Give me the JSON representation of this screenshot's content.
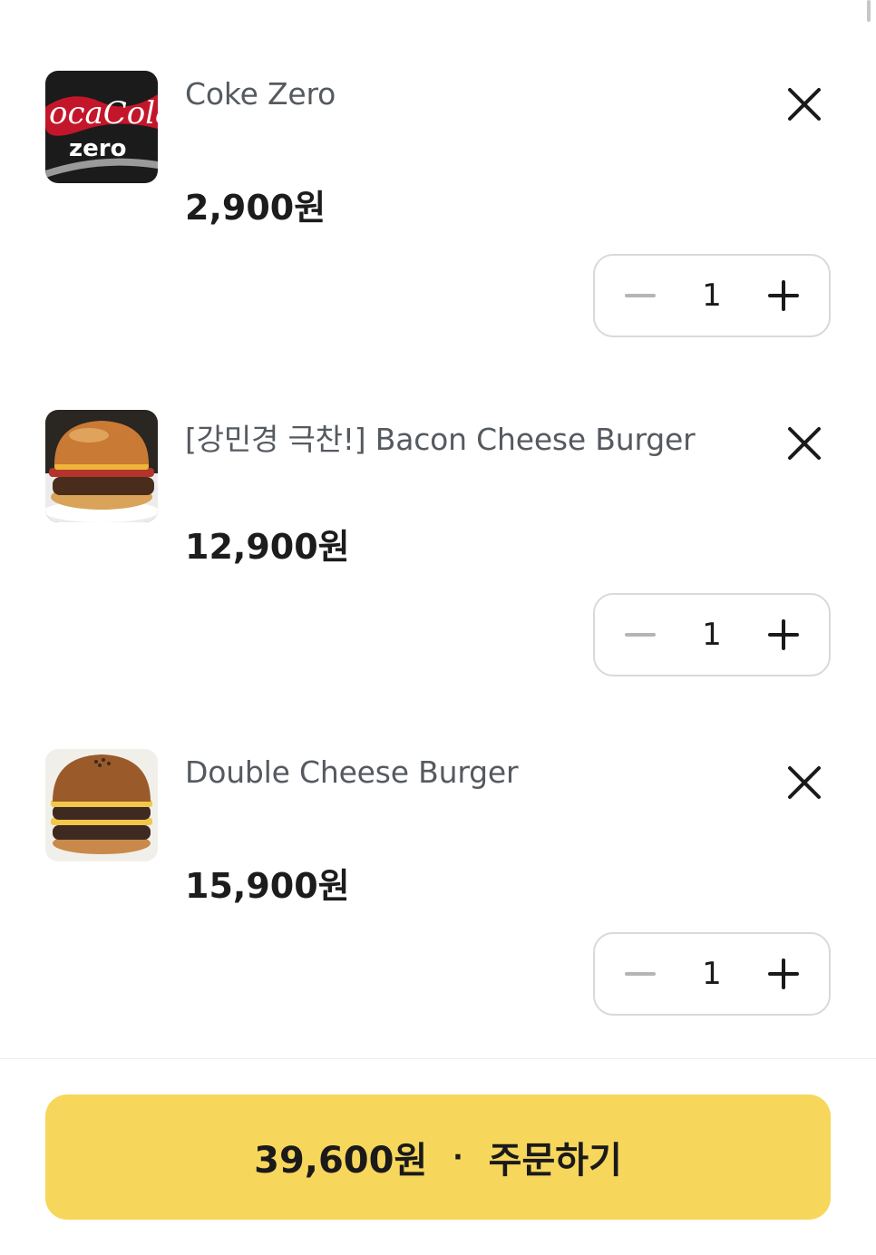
{
  "cart": {
    "items": [
      {
        "name": "Coke Zero",
        "price": "2,900원",
        "quantity": "1",
        "thumbnail_icon": "coke-zero-can"
      },
      {
        "name": "[강민경 극찬!] Bacon Cheese Burger",
        "price": "12,900원",
        "quantity": "1",
        "thumbnail_icon": "bacon-cheese-burger"
      },
      {
        "name": "Double Cheese Burger",
        "price": "15,900원",
        "quantity": "1",
        "thumbnail_icon": "double-cheese-burger"
      }
    ]
  },
  "order": {
    "total": "39,600원",
    "separator": "·",
    "label": "주문하기"
  },
  "colors": {
    "accent": "#f7d65c",
    "item_name": "#555a60",
    "stepper_border": "#d9d9d9"
  }
}
